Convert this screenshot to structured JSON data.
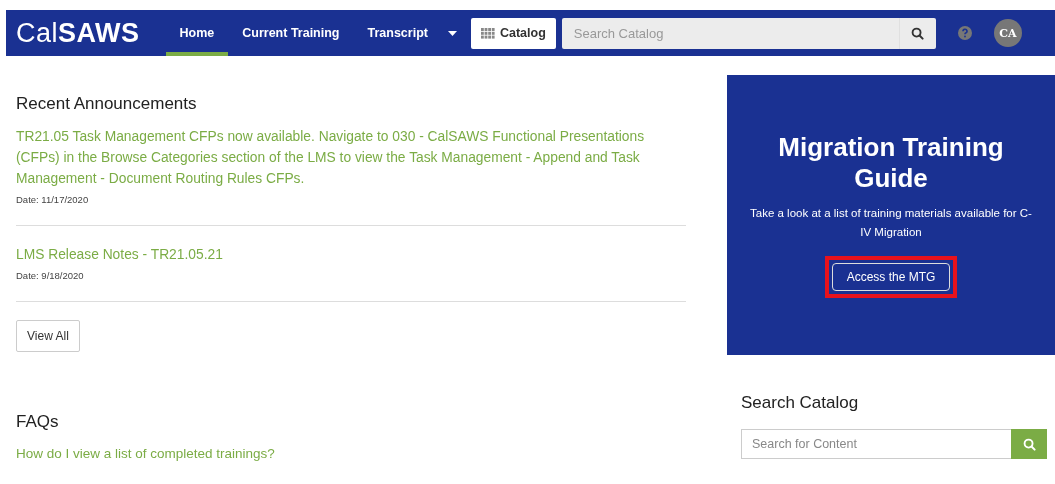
{
  "nav": {
    "logo_light": "Cal",
    "logo_bold": "SAWS",
    "tabs": [
      {
        "label": "Home",
        "selected": true
      },
      {
        "label": "Current Training",
        "selected": false
      },
      {
        "label": "Transcript",
        "selected": false
      }
    ],
    "catalog_button": "Catalog",
    "search": {
      "placeholder": "Search Catalog"
    },
    "avatar": "CA"
  },
  "announcements": {
    "title": "Recent Announcements",
    "items": [
      {
        "text": "TR21.05 Task Management CFPs now available. Navigate to 030 - CalSAWS Functional Presentations (CFPs) in the Browse Categories section of the LMS to view the Task Management - Append and Task Management - Document Routing Rules CFPs.",
        "date": "Date: 11/17/2020"
      },
      {
        "text": "LMS Release Notes - TR21.05.21",
        "date": "Date: 9/18/2020"
      }
    ],
    "view_all": "View All"
  },
  "faqs": {
    "title": "FAQs",
    "items": [
      "How do I view a list of completed trainings?"
    ]
  },
  "promo": {
    "title": "Migration Training Guide",
    "text": "Take a look at a list of training materials available for C-IV Migration",
    "button": {
      "label": "Access the MTG",
      "highlighted": true
    }
  },
  "search_catalog": {
    "title": "Search Catalog",
    "placeholder": "Search for Content"
  }
}
